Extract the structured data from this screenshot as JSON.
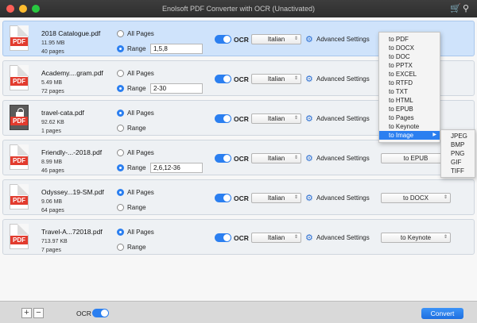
{
  "window": {
    "title": "Enolsoft PDF Converter with OCR (Unactivated)"
  },
  "icons": {
    "cart": "cart-icon",
    "broom": "broom-icon",
    "gear": "gear-icon",
    "lock": "lock-icon"
  },
  "colors": {
    "accent": "#2b7ff0",
    "pdf_badge": "#e23b2e",
    "selected_row": "#cfe3fb"
  },
  "files": [
    {
      "name": "2018 Catalogue.pdf",
      "size": "11.95 MB",
      "pages": "40 pages",
      "all_pages_label": "All Pages",
      "range_label": "Range",
      "range_value": "1,5,8",
      "ocr_label": "OCR",
      "language": "Italian",
      "advanced_label": "Advanced Settings"
    },
    {
      "name": "Academy....gram.pdf",
      "size": "5.49 MB",
      "pages": "72 pages",
      "all_pages_label": "All Pages",
      "range_label": "Range",
      "range_value": "2-30",
      "ocr_label": "OCR",
      "language": "Italian",
      "advanced_label": "Advanced Settings"
    },
    {
      "name": "travel-cata.pdf",
      "size": "92.62 KB",
      "pages": "1 pages",
      "all_pages_label": "All Pages",
      "range_label": "Range",
      "ocr_label": "OCR",
      "language": "Italian",
      "advanced_label": "Advanced Settings"
    },
    {
      "name": "Friendly-...-2018.pdf",
      "size": "8.99 MB",
      "pages": "46 pages",
      "all_pages_label": "All Pages",
      "range_label": "Range",
      "range_value": "2,6,12-36",
      "ocr_label": "OCR",
      "language": "Italian",
      "advanced_label": "Advanced Settings",
      "format": "to EPUB"
    },
    {
      "name": "Odyssey...19-SM.pdf",
      "size": "9.06 MB",
      "pages": "64 pages",
      "all_pages_label": "All Pages",
      "range_label": "Range",
      "ocr_label": "OCR",
      "language": "Italian",
      "advanced_label": "Advanced Settings",
      "format": "to DOCX"
    },
    {
      "name": "Travel-A...72018.pdf",
      "size": "713.97 KB",
      "pages": "7 pages",
      "all_pages_label": "All Pages",
      "range_label": "Range",
      "ocr_label": "OCR",
      "language": "Italian",
      "advanced_label": "Advanced Settings",
      "format": "to Keynote"
    }
  ],
  "format_menu": {
    "items": [
      "to PDF",
      "to DOCX",
      "to DOC",
      "to PPTX",
      "to EXCEL",
      "to RTFD",
      "to TXT",
      "to HTML",
      "to EPUB",
      "to Pages",
      "to Keynote",
      "to Image"
    ],
    "highlighted": "to Image",
    "image_submenu": [
      "JPEG",
      "BMP",
      "PNG",
      "GIF",
      "TIFF"
    ]
  },
  "bottom_bar": {
    "add_label": "+",
    "remove_label": "−",
    "ocr_label": "OCR",
    "convert_label": "Convert"
  }
}
